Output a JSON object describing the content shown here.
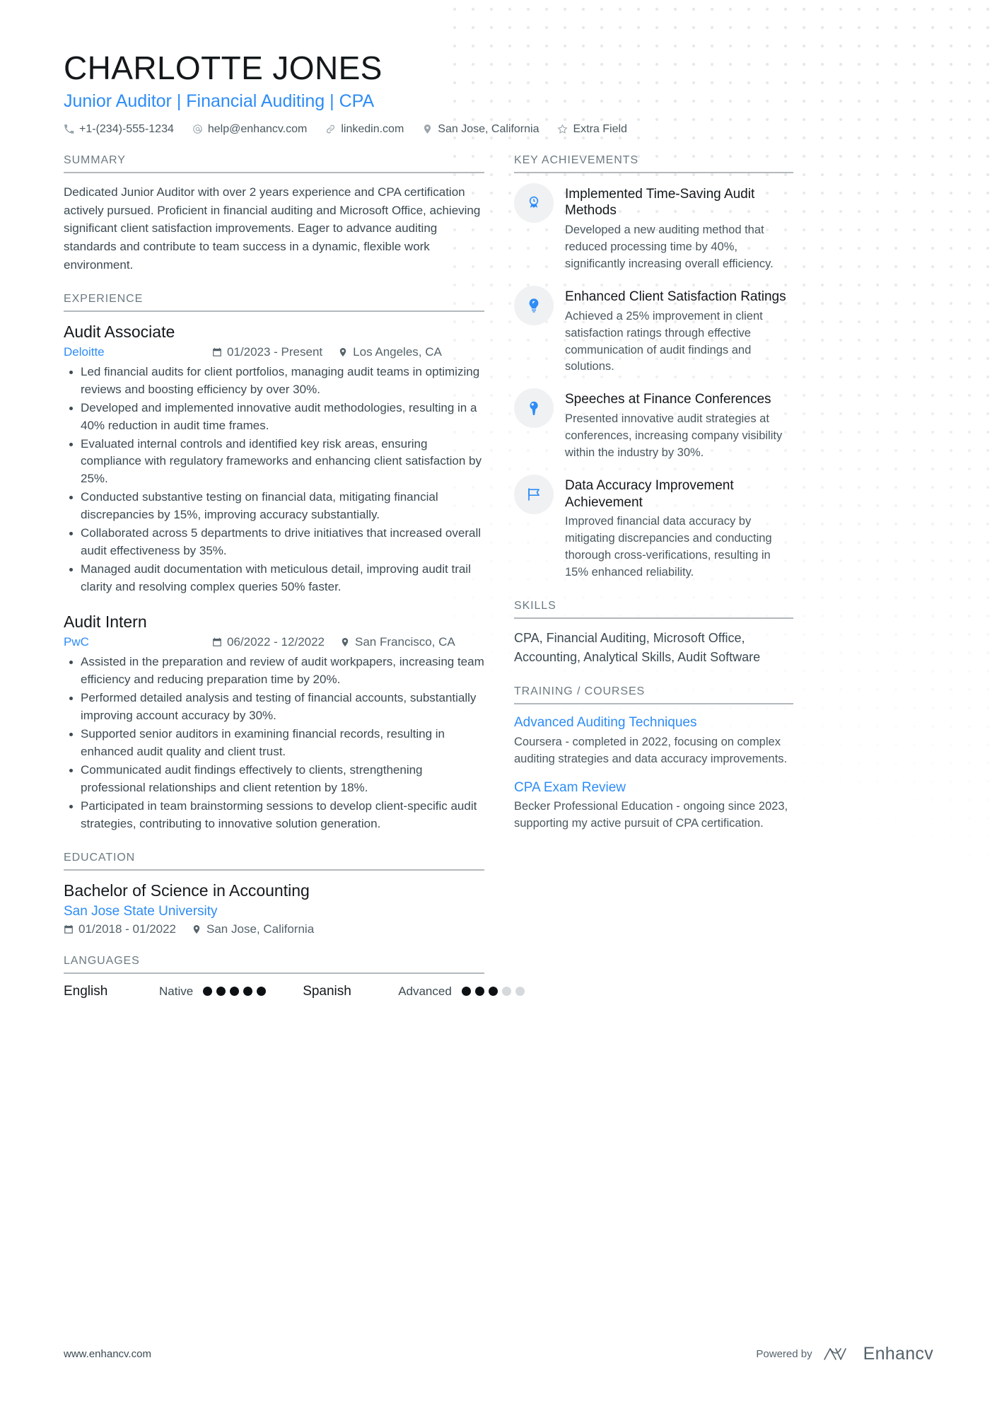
{
  "header": {
    "name": "CHARLOTTE JONES",
    "headline": "Junior Auditor | Financial Auditing | CPA",
    "accent_color": "#2d8cf6",
    "contacts": [
      {
        "icon": "phone-icon",
        "text": "+1-(234)-555-1234"
      },
      {
        "icon": "email-icon",
        "text": "help@enhancv.com"
      },
      {
        "icon": "link-icon",
        "text": "linkedin.com"
      },
      {
        "icon": "location-pin-icon",
        "text": "San Jose, California"
      },
      {
        "icon": "star-icon",
        "text": "Extra Field"
      }
    ]
  },
  "summary": {
    "section_title": "SUMMARY",
    "text": "Dedicated Junior Auditor with over 2 years experience and CPA certification actively pursued. Proficient in financial auditing and Microsoft Office, achieving significant client satisfaction improvements. Eager to advance auditing standards and contribute to team success in a dynamic, flexible work environment."
  },
  "experience": {
    "section_title": "EXPERIENCE",
    "entries": [
      {
        "title": "Audit Associate",
        "organization": "Deloitte",
        "dates": "01/2023 - Present",
        "location": "Los Angeles, CA",
        "bullets": [
          "Led financial audits for client portfolios, managing audit teams in optimizing reviews and boosting efficiency by over 30%.",
          "Developed and implemented innovative audit methodologies, resulting in a 40% reduction in audit time frames.",
          "Evaluated internal controls and identified key risk areas, ensuring compliance with regulatory frameworks and enhancing client satisfaction by 25%.",
          "Conducted substantive testing on financial data, mitigating financial discrepancies by 15%, improving accuracy substantially.",
          "Collaborated across 5 departments to drive initiatives that increased overall audit effectiveness by 35%.",
          "Managed audit documentation with meticulous detail, improving audit trail clarity and resolving complex queries 50% faster."
        ]
      },
      {
        "title": "Audit Intern",
        "organization": "PwC",
        "dates": "06/2022 - 12/2022",
        "location": "San Francisco, CA",
        "bullets": [
          "Assisted in the preparation and review of audit workpapers, increasing team efficiency and reducing preparation time by 20%.",
          "Performed detailed analysis and testing of financial accounts, substantially improving account accuracy by 30%.",
          "Supported senior auditors in examining financial records, resulting in enhanced audit quality and client trust.",
          "Communicated audit findings effectively to clients, strengthening professional relationships and client retention by 18%.",
          "Participated in team brainstorming sessions to develop client-specific audit strategies, contributing to innovative solution generation."
        ]
      }
    ]
  },
  "education": {
    "section_title": "EDUCATION",
    "entries": [
      {
        "degree": "Bachelor of Science in Accounting",
        "school": "San Jose State University",
        "dates": "01/2018 - 01/2022",
        "location": "San Jose, California"
      }
    ]
  },
  "languages": {
    "section_title": "LANGUAGES",
    "items": [
      {
        "name": "English",
        "level": "Native",
        "filled": 5,
        "total": 5
      },
      {
        "name": "Spanish",
        "level": "Advanced",
        "filled": 3,
        "total": 5
      }
    ]
  },
  "key_achievements": {
    "section_title": "KEY ACHIEVEMENTS",
    "items": [
      {
        "icon": "award-badge-icon",
        "title": "Implemented Time-Saving Audit Methods",
        "text": "Developed a new auditing method that reduced processing time by 40%, significantly increasing overall efficiency."
      },
      {
        "icon": "lightbulb-icon",
        "title": "Enhanced Client Satisfaction Ratings",
        "text": "Achieved a 25% improvement in client satisfaction ratings through effective communication of audit findings and solutions."
      },
      {
        "icon": "microphone-icon",
        "title": "Speeches at Finance Conferences",
        "text": "Presented innovative audit strategies at conferences, increasing company visibility within the industry by 30%."
      },
      {
        "icon": "flag-icon",
        "title": "Data Accuracy Improvement Achievement",
        "text": "Improved financial data accuracy by mitigating discrepancies and conducting thorough cross-verifications, resulting in 15% enhanced reliability."
      }
    ]
  },
  "skills": {
    "section_title": "SKILLS",
    "text": "CPA, Financial Auditing, Microsoft Office, Accounting, Analytical Skills, Audit Software"
  },
  "training": {
    "section_title": "TRAINING / COURSES",
    "items": [
      {
        "title": "Advanced Auditing Techniques",
        "text": "Coursera - completed in 2022, focusing on complex auditing strategies and data accuracy improvements."
      },
      {
        "title": "CPA Exam Review",
        "text": "Becker Professional Education - ongoing since 2023, supporting my active pursuit of CPA certification."
      }
    ]
  },
  "footer": {
    "url": "www.enhancv.com",
    "powered_by": "Powered by",
    "brand": "Enhancv"
  }
}
